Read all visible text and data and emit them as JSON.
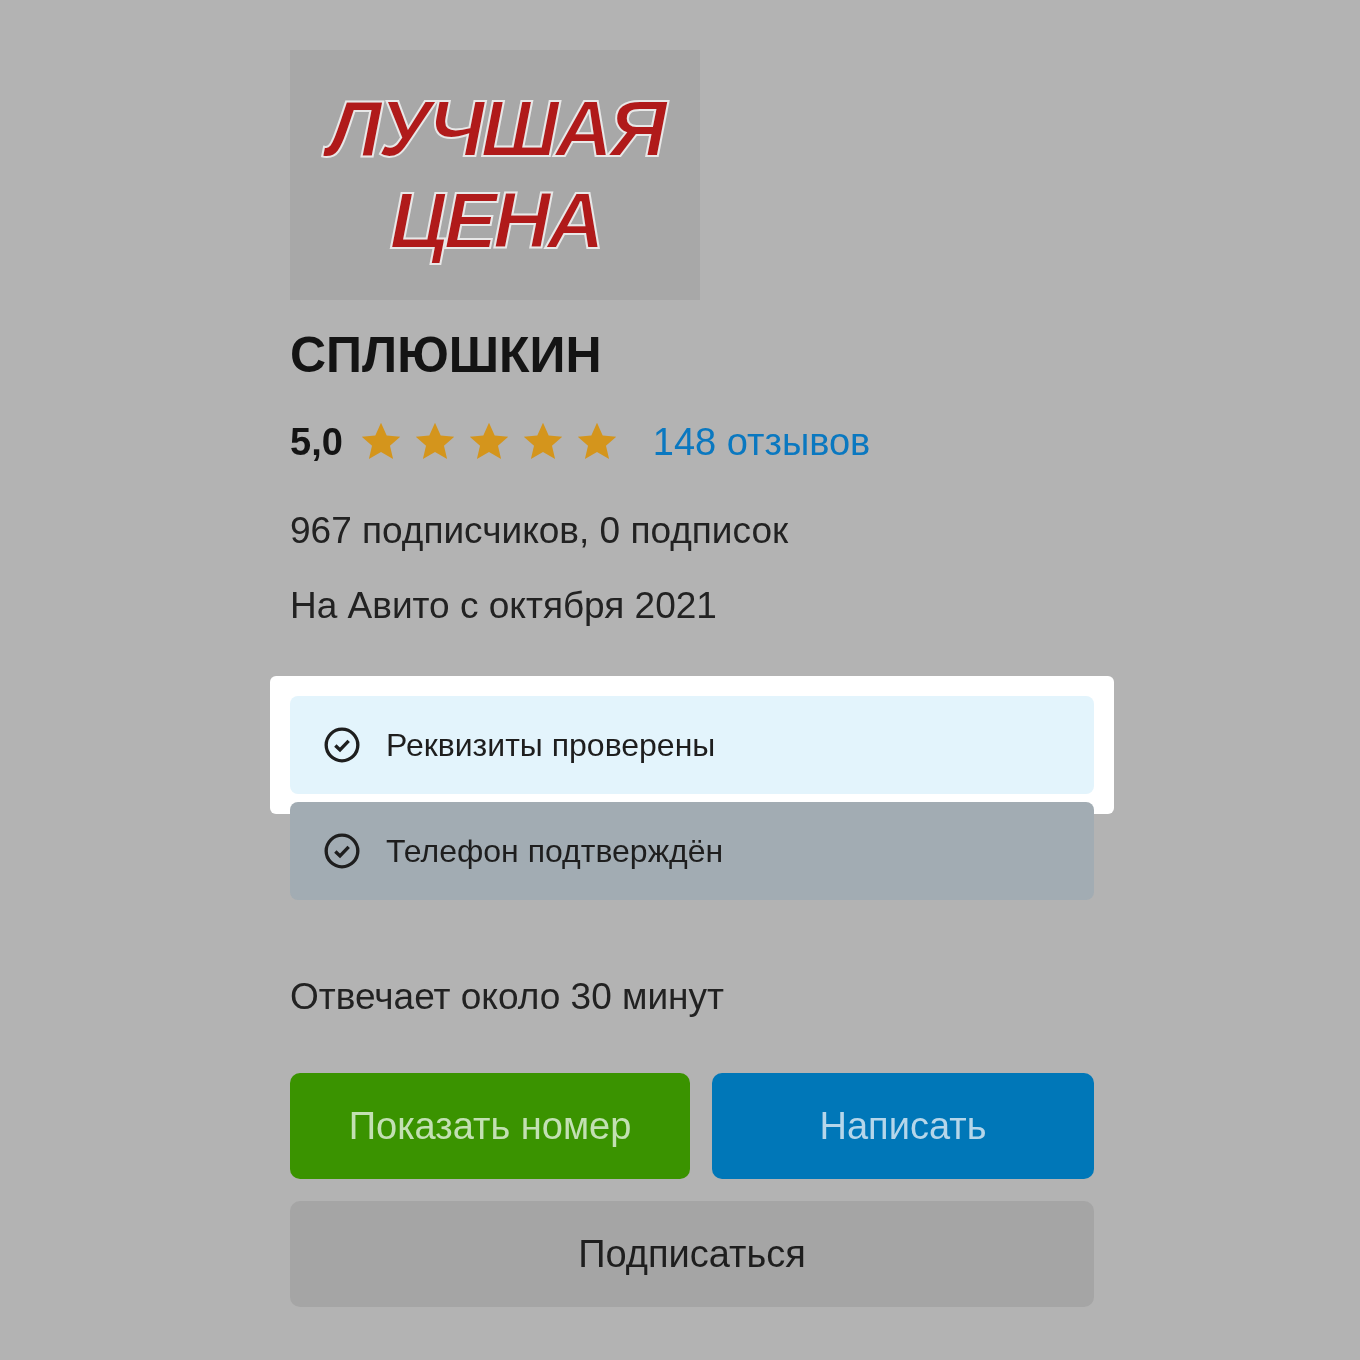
{
  "logo": {
    "lines": [
      "ЛУЧШАЯ",
      "ЦЕНА"
    ]
  },
  "seller": {
    "name": "СПЛЮШКИН",
    "rating": "5,0",
    "stars": 5,
    "reviews": "148 отзывов"
  },
  "followers": "967 подписчиков, 0 подписок",
  "since": "На Авито с октября 2021",
  "badges": [
    {
      "label": "Реквизиты проверены",
      "highlighted": true
    },
    {
      "label": "Телефон подтверждён",
      "highlighted": false
    }
  ],
  "response_time": "Отвечает около 30 минут",
  "buttons": [
    {
      "label": "Показать номер",
      "kind": "green"
    },
    {
      "label": "Написать",
      "kind": "blue"
    },
    {
      "label": "Подписаться",
      "kind": "gray"
    }
  ]
}
